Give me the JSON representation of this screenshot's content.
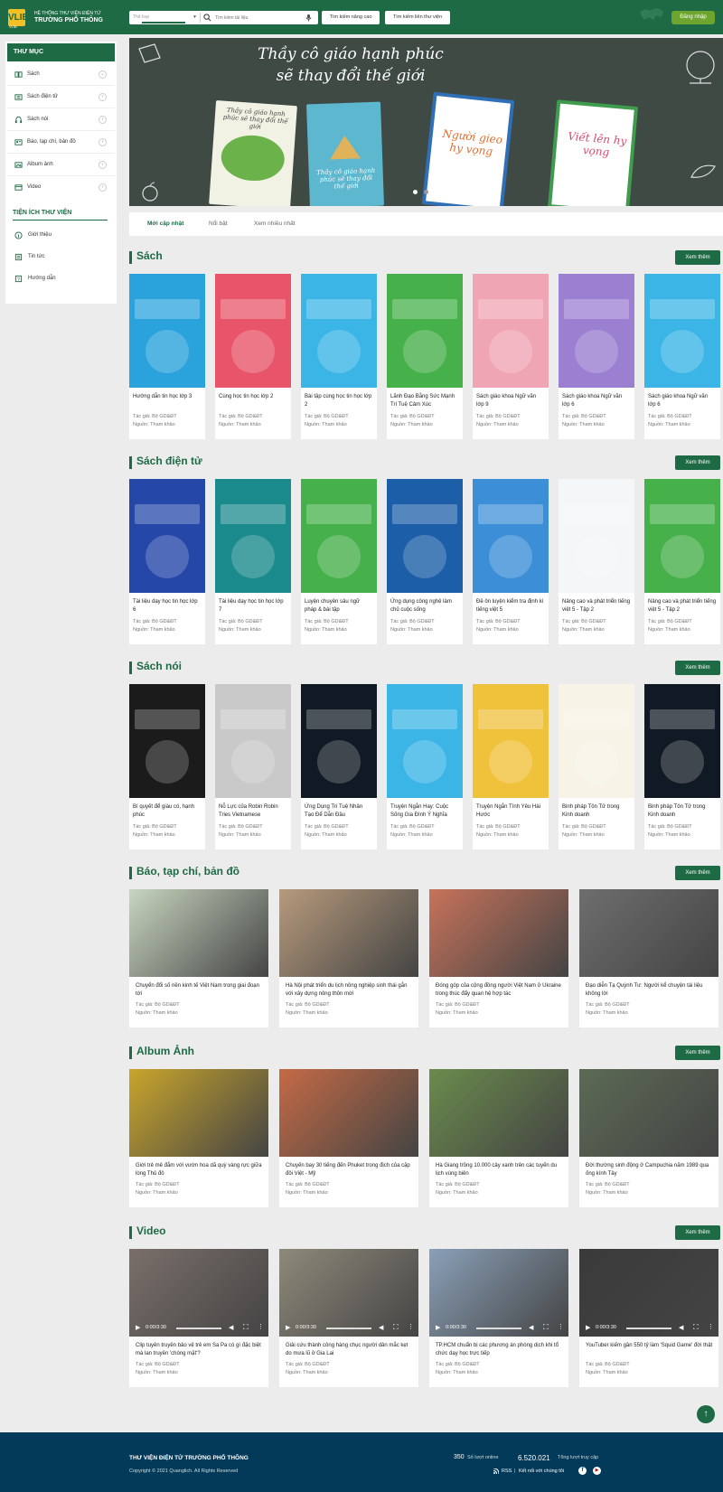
{
  "header": {
    "logo_text": "VLIB",
    "logo_sub": "VLIB",
    "system_label": "HỆ THỐNG THƯ VIỆN ĐIỆN TỬ",
    "school_name": "TRƯỜNG PHỔ THÔNG",
    "search_type": "Thể loại",
    "search_placeholder": "Tìm kiếm tài liệu",
    "advanced_search": "Tìm kiếm nâng cao",
    "member_search": "Tìm kiếm liên thư viện",
    "login": "Đăng nhập"
  },
  "sidebar": {
    "title": "THƯ MỤC",
    "categories": [
      {
        "label": "Sách",
        "icon": "book-icon"
      },
      {
        "label": "Sách điện tử",
        "icon": "ebook-icon"
      },
      {
        "label": "Sách nói",
        "icon": "headphones-icon"
      },
      {
        "label": "Báo, tạp chí, bản đồ",
        "icon": "newspaper-icon"
      },
      {
        "label": "Album ảnh",
        "icon": "image-icon"
      },
      {
        "label": "Video",
        "icon": "video-icon"
      }
    ],
    "utility_title": "TIỆN ÍCH THƯ VIỆN",
    "utilities": [
      {
        "label": "Giới thiệu",
        "icon": "info-icon"
      },
      {
        "label": "Tin tức",
        "icon": "news-icon"
      },
      {
        "label": "Hướng dẫn",
        "icon": "help-icon"
      }
    ]
  },
  "banner": {
    "line1": "Thầy cô giáo hạnh phúc",
    "line2": "sẽ thay đổi thế giới",
    "books": [
      "Thầy cô giáo hạnh phúc sẽ thay đổi thế giới",
      "Thầy cô giáo hạnh phúc sẽ thay đổi thế giới",
      "Người gieo hy vọng",
      "Viết lên hy vọng"
    ]
  },
  "tabs": [
    "Mới cập nhật",
    "Nổi bật",
    "Xem nhiều nhất"
  ],
  "more_label": "Xem thêm",
  "sections": {
    "sach": {
      "title": "Sách",
      "items": [
        {
          "title": "Hướng dẫn tin học lớp 3",
          "author": "Tác giả: Bộ GD&ĐT",
          "source": "Nguồn: Tham khảo",
          "color": "#2aa3dc"
        },
        {
          "title": "Cùng học tin học lớp 2",
          "author": "Tác giả: Bộ GD&ĐT",
          "source": "Nguồn: Tham khảo",
          "color": "#e8556a"
        },
        {
          "title": "Bài tập cùng học tin học lớp 2",
          "author": "Tác giả: Bộ GD&ĐT",
          "source": "Nguồn: Tham khảo",
          "color": "#3bb4e6"
        },
        {
          "title": "Lãnh Đạo Bằng Sức Mạnh Trí Tuệ Cảm Xúc",
          "author": "Tác giả: Bộ GD&ĐT",
          "source": "Nguồn: Tham khảo",
          "color": "#46b04a"
        },
        {
          "title": "Sách giáo khoa Ngữ văn lớp 9",
          "author": "Tác giả: Bộ GD&ĐT",
          "source": "Nguồn: Tham khảo",
          "color": "#f0a5b5"
        },
        {
          "title": "Sách giáo khoa Ngữ văn lớp 6",
          "author": "Tác giả: Bộ GD&ĐT",
          "source": "Nguồn: Tham khảo",
          "color": "#9b7fd0"
        },
        {
          "title": "Sách giáo khoa Ngữ văn lớp 6",
          "author": "Tác giả: Bộ GD&ĐT",
          "source": "Nguồn: Tham khảo",
          "color": "#3bb4e6"
        }
      ]
    },
    "ebook": {
      "title": "Sách điện tử",
      "items": [
        {
          "title": "Tài liệu dạy học tin học lớp 6",
          "author": "Tác giả: Bộ GD&ĐT",
          "source": "Nguồn: Tham khảo",
          "color": "#2547a8"
        },
        {
          "title": "Tài liệu dạy học tin học lớp 7",
          "author": "Tác giả: Bộ GD&ĐT",
          "source": "Nguồn: Tham khảo",
          "color": "#1b8a8c"
        },
        {
          "title": "Luyện chuyên sâu ngữ pháp & bài tập",
          "author": "Tác giả: Bộ GD&ĐT",
          "source": "Nguồn: Tham khảo",
          "color": "#46b04a"
        },
        {
          "title": "Ứng dụng công nghệ làm chủ cuộc sống",
          "author": "Tác giả: Bộ GD&ĐT",
          "source": "Nguồn: Tham khảo",
          "color": "#1c5fa8"
        },
        {
          "title": "Đề ôn luyện kiểm tra định kì tiếng việt 5",
          "author": "Tác giả: Bộ GD&ĐT",
          "source": "Nguồn: Tham khảo",
          "color": "#3c8fd6"
        },
        {
          "title": "Nâng cao và phát triển tiếng việt 5 - Tập 2",
          "author": "Tác giả: Bộ GD&ĐT",
          "source": "Nguồn: Tham khảo",
          "color": "#f4f6f8"
        },
        {
          "title": "Nâng cao và phát triển tiếng việt 5 - Tập 2",
          "author": "Tác giả: Bộ GD&ĐT",
          "source": "Nguồn: Tham khảo",
          "color": "#46b04a"
        }
      ]
    },
    "audio": {
      "title": "Sách nói",
      "items": [
        {
          "title": "Bí quyết để giàu có, hạnh phúc",
          "author": "Tác giả: Bộ GD&ĐT",
          "source": "Nguồn: Tham khảo",
          "color": "#1b1b1b"
        },
        {
          "title": "Nỗ Lực của Robin Robin Tries Vietnamese",
          "author": "Tác giả: Bộ GD&ĐT",
          "source": "Nguồn: Tham khảo",
          "color": "#c9c9c9"
        },
        {
          "title": "Ứng Dụng Trí Tuệ Nhân Tạo Để Dẫn Đầu",
          "author": "Tác giả: Bộ GD&ĐT",
          "source": "Nguồn: Tham khảo",
          "color": "#111a24"
        },
        {
          "title": "Truyện Ngắn Hay: Cuộc Sống Gia Đình Ý Nghĩa",
          "author": "Tác giả: Bộ GD&ĐT",
          "source": "Nguồn: Tham khảo",
          "color": "#3bb4e6"
        },
        {
          "title": "Truyện Ngắn Tình Yêu Hài Hước",
          "author": "Tác giả: Bộ GD&ĐT",
          "source": "Nguồn: Tham khảo",
          "color": "#f0c13b"
        },
        {
          "title": "Binh pháp Tôn Tử trong Kinh doanh",
          "author": "Tác giả: Bộ GD&ĐT",
          "source": "Nguồn: Tham khảo",
          "color": "#f7f3e6"
        },
        {
          "title": "Binh pháp Tôn Tử trong Kinh doanh",
          "author": "Tác giả: Bộ GD&ĐT",
          "source": "Nguồn: Tham khảo",
          "color": "#111a24"
        }
      ]
    },
    "news": {
      "title": "Báo, tạp chí, bản đồ",
      "items": [
        {
          "title": "Chuyển đổi số nền kinh tế Việt Nam trong giai đoạn tới",
          "author": "Tác giả: Bộ GD&ĐT",
          "source": "Nguồn: Tham khảo",
          "color": "#c8d6c0"
        },
        {
          "title": "Hà Nội phát triển du lịch nông nghiệp sinh thái gắn với xây dựng nông thôn mới",
          "author": "Tác giả: Bộ GD&ĐT",
          "source": "Nguồn: Tham khảo",
          "color": "#b79a7c"
        },
        {
          "title": "Đóng góp của cộng đồng người Việt Nam ở Ukraine trong thúc đẩy quan hệ hợp tác",
          "author": "Tác giả: Bộ GD&ĐT",
          "source": "Nguồn: Tham khảo",
          "color": "#c7735a"
        },
        {
          "title": "Đạo diễn Tạ Quỳnh Tư: Người kể chuyện tài liệu không lời",
          "author": "Tác giả: Bộ GD&ĐT",
          "source": "Nguồn: Tham khảo",
          "color": "#6e6e6e"
        }
      ]
    },
    "album": {
      "title": "Album Ảnh",
      "items": [
        {
          "title": "Giới trẻ mê đắm với vườn hoa dã quỳ vàng rực giữa lòng Thủ đô",
          "author": "Tác giả: Bộ GD&ĐT",
          "source": "Nguồn: Tham khảo",
          "color": "#c9a52c"
        },
        {
          "title": "Chuyến bay 30 tiếng đến Phuket trong địch của cặp đôi Việt - Mỹ",
          "author": "Tác giả: Bộ GD&ĐT",
          "source": "Nguồn: Tham khảo",
          "color": "#c46a45"
        },
        {
          "title": "Hà Giang trồng 10.000 cây xanh trên các tuyến du lịch vùng biên",
          "author": "Tác giả: Bộ GD&ĐT",
          "source": "Nguồn: Tham khảo",
          "color": "#6a8b4c"
        },
        {
          "title": "Đời thường sinh động ở Campuchia năm 1989 qua ống kính Tây",
          "author": "Tác giả: Bộ GD&ĐT",
          "source": "Nguồn: Tham khảo",
          "color": "#5c6a55"
        }
      ]
    },
    "video": {
      "title": "Video",
      "items": [
        {
          "title": "Clip tuyên truyền bảo vệ trẻ em Sa Pa có gì đặc biệt mà lan truyền 'chóng mặt'?",
          "author": "Tác giả: Bộ GD&ĐT",
          "source": "Nguồn: Tham khảo",
          "color": "#7a6f6a",
          "time": "0:00/3:30"
        },
        {
          "title": "Giải cứu thành công hàng chục người dân mắc kẹt do mưa lũ ở Gia Lai",
          "author": "Tác giả: Bộ GD&ĐT",
          "source": "Nguồn: Tham khảo",
          "color": "#8e8a7a",
          "time": "0:00/3:30"
        },
        {
          "title": "TP.HCM chuẩn bị các phương án phòng dịch khi tổ chức dạy học trực tiếp",
          "author": "Tác giả: Bộ GD&ĐT",
          "source": "Nguồn: Tham khảo",
          "color": "#8aa0b8",
          "time": "0:00/3:30"
        },
        {
          "title": "YouTuber kiếm gần 550 tỷ làm 'Squid Game' đời thật",
          "author": "Tác giả: Bộ GD&ĐT",
          "source": "Nguồn: Tham khảo",
          "color": "#3a3a3a",
          "time": "0:00/3:30"
        }
      ]
    }
  },
  "footer": {
    "title": "THƯ VIỆN ĐIỆN TỬ TRƯỜNG PHỔ THÔNG",
    "copyright": "Copyright © 2021 Quanglich. All Rights Reserved",
    "online_count": "350",
    "online_label": "Số lượt online",
    "total_count": "6.520.021",
    "total_label": "Tổng lượt truy cập",
    "rss": "RSS",
    "connect": "Kết nối với chúng tôi"
  }
}
